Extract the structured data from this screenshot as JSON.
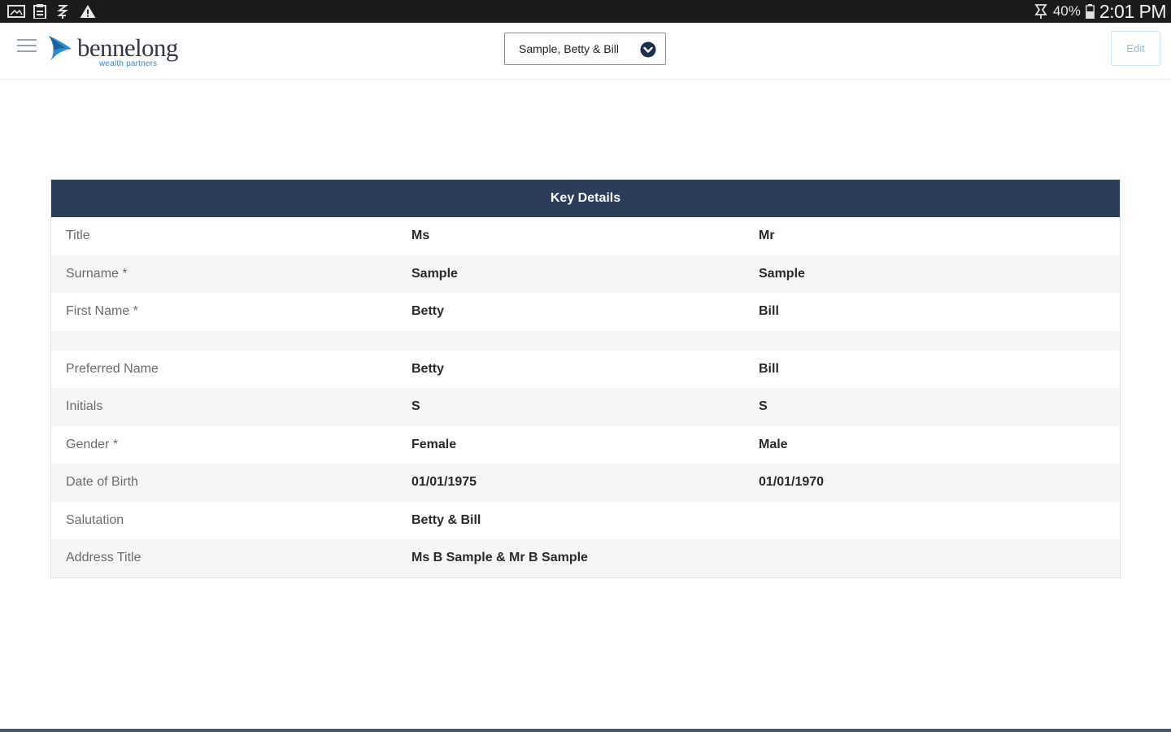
{
  "status_bar": {
    "battery_percent": "40%",
    "time": "2:01 PM",
    "left_icons": [
      "gallery-icon",
      "clipboard-icon",
      "usb-icon",
      "warning-icon"
    ],
    "right_icons": [
      "alarm-icon",
      "battery-icon"
    ]
  },
  "header": {
    "logo_text": "bennelong",
    "logo_subtext": "wealth partners",
    "client_selector": "Sample, Betty & Bill",
    "edit_label": "Edit",
    "colors": {
      "logo_mark": "#2b8ad6",
      "logo_text": "#333a45",
      "edit": "#8bbde0"
    }
  },
  "key_details": {
    "title": "Key Details",
    "header_color": "#2b3d59",
    "rows": [
      {
        "label": "Title",
        "a": "Ms",
        "b": "Mr"
      },
      {
        "label": "Surname *",
        "a": "Sample",
        "b": "Sample"
      },
      {
        "label": "First Name *",
        "a": "Betty",
        "b": "Bill"
      },
      {
        "label": "",
        "a": "",
        "b": ""
      },
      {
        "label": "Preferred Name",
        "a": "Betty",
        "b": "Bill"
      },
      {
        "label": "Initials",
        "a": "S",
        "b": "S"
      },
      {
        "label": "Gender *",
        "a": "Female",
        "b": "Male"
      },
      {
        "label": "Date of Birth",
        "a": "01/01/1975",
        "b": "01/01/1970"
      },
      {
        "label": "Salutation",
        "a": "Betty & Bill",
        "b": ""
      },
      {
        "label": "Address Title",
        "a": "Ms B Sample & Mr B Sample",
        "b": ""
      }
    ]
  }
}
